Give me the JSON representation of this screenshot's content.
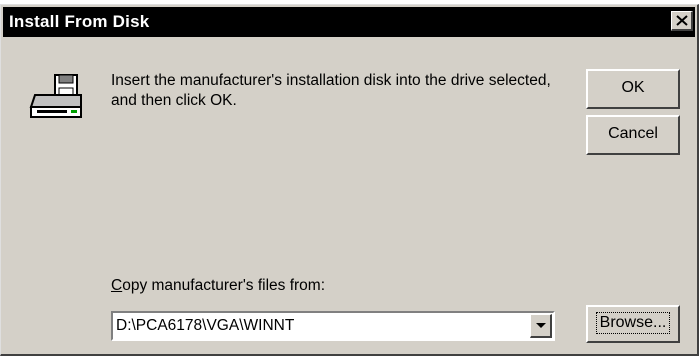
{
  "window": {
    "title": "Install From Disk"
  },
  "message": {
    "text": "Insert the manufacturer's installation disk into the drive selected, and then click OK."
  },
  "buttons": {
    "ok_label": "OK",
    "cancel_label": "Cancel",
    "browse_label": "Browse..."
  },
  "copy_from": {
    "label_accel": "C",
    "label_rest": "opy manufacturer's files from:",
    "value": "D:\\PCA6178\\VGA\\WINNT"
  },
  "icons": {
    "dialog_icon": "disk-drive-icon",
    "close": "close-icon",
    "dropdown": "chevron-down-icon"
  }
}
